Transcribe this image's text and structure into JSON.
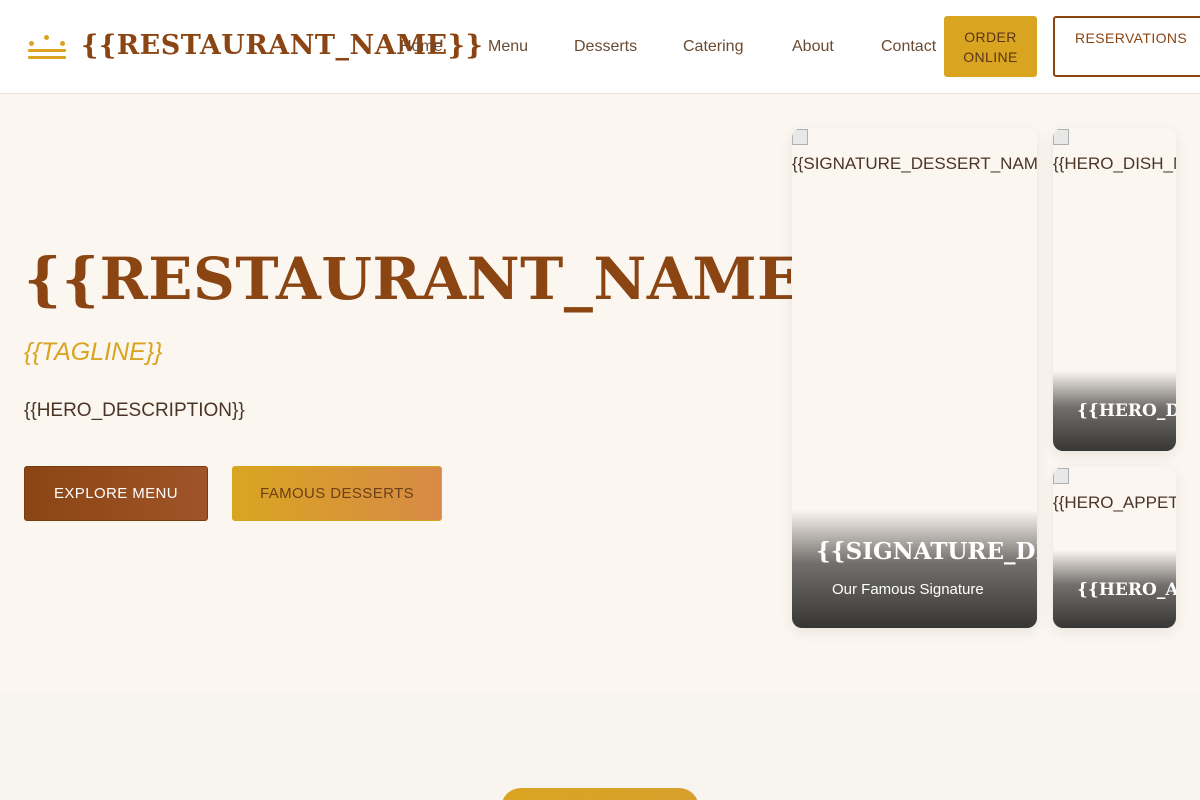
{
  "header": {
    "brand": "{{RESTAURANT_NAME}}",
    "nav": [
      "Home",
      "Menu",
      "Desserts",
      "Catering",
      "About",
      "Contact"
    ],
    "order_label": "ORDER ONLINE",
    "reservations_label": "RESERVATIONS"
  },
  "hero": {
    "title": "{{RESTAURANT_NAME}}",
    "tagline": "{{TAGLINE}}",
    "description": "{{HERO_DESCRIPTION}}",
    "explore_label": "EXPLORE MENU",
    "famous_label": "FAMOUS DESSERTS"
  },
  "cards": {
    "signature": {
      "alt": "{{SIGNATURE_DESSERT_NAME}}",
      "title": "{{SIGNATURE_DESSERT_NAME}}",
      "subtitle": "Our Famous Signature"
    },
    "dish": {
      "alt": "{{HERO_DISH_NAME}}",
      "title": "{{HERO_DISH_NAME}}"
    },
    "appetizer": {
      "alt": "{{HERO_APPETIZER_NAME}}",
      "title": "{{HERO_APPETIZER_NAME}}"
    }
  },
  "colors": {
    "brand_brown": "#8b4513",
    "gold": "#d9a521",
    "hero_bg": "#fcf6f0"
  }
}
